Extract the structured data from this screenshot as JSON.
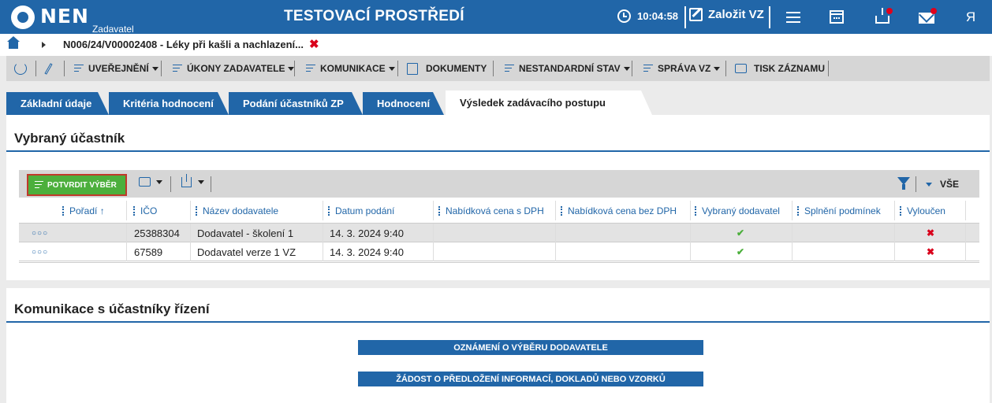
{
  "header": {
    "logo_text": "NEN",
    "logo_sub": "Zadavatel",
    "environment_title": "TESTOVACÍ PROSTŘEDÍ",
    "clock_time": "10:04:58",
    "create_label": "Založit VZ",
    "icons": [
      "clock-icon",
      "pen-icon",
      "menu-icon",
      "calendar-icon",
      "inbox-icon",
      "mail-icon",
      "user-icon"
    ],
    "user_glyph": "Я"
  },
  "breadcrumb": {
    "text": "N006/24/V00002408 - Léky při kašli a nachlazení...",
    "close_glyph": "✖"
  },
  "toolbar": {
    "items": [
      {
        "label": "UVEŘEJNĚNÍ"
      },
      {
        "label": "ÚKONY ZADAVATELE"
      },
      {
        "label": "KOMUNIKACE"
      },
      {
        "label": "DOKUMENTY"
      },
      {
        "label": "NESTANDARDNÍ STAV"
      },
      {
        "label": "SPRÁVA VZ"
      },
      {
        "label": "TISK ZÁZNAMU"
      }
    ]
  },
  "tabs": [
    {
      "label": "Základní údaje"
    },
    {
      "label": "Kritéria hodnocení"
    },
    {
      "label": "Podání účastníků ZP"
    },
    {
      "label": "Hodnocení"
    },
    {
      "label": "Výsledek zadávacího postupu",
      "active": true
    }
  ],
  "section_selected": {
    "title": "Vybraný účastník",
    "confirm_button": "POTVRDIT VÝBĚR",
    "view_all": "VŠE",
    "columns": [
      "Pořadí ↑",
      "IČO",
      "Název dodavatele",
      "Datum podání",
      "Nabídková cena s DPH",
      "Nabídková cena bez DPH",
      "Vybraný dodavatel",
      "Splnění podmínek",
      "Vyloučen"
    ],
    "rows": [
      {
        "menu": "○○○",
        "ico": "25388304",
        "name": "Dodavatel - školení 1",
        "date": "14. 3. 2024 9:40",
        "price_vat": "",
        "price_novat": "",
        "selected": "✔",
        "conditions": "",
        "excluded": "✖"
      },
      {
        "menu": "○○○",
        "ico": "67589",
        "name": "Dodavatel verze 1 VZ",
        "date": "14. 3. 2024 9:40",
        "price_vat": "",
        "price_novat": "",
        "selected": "✔",
        "conditions": "",
        "excluded": "✖"
      }
    ]
  },
  "section_communication": {
    "title": "Komunikace s účastníky řízení",
    "buttons": [
      {
        "label": "OZNÁMENÍ O VÝBĚRU DODAVATELE"
      },
      {
        "label": "ŽÁDOST O PŘEDLOŽENÍ INFORMACÍ, DOKLADŮ NEBO VZORKŮ"
      }
    ]
  },
  "colors": {
    "primary": "#2166a8",
    "success": "#4caf3c",
    "danger": "#d9001b"
  }
}
